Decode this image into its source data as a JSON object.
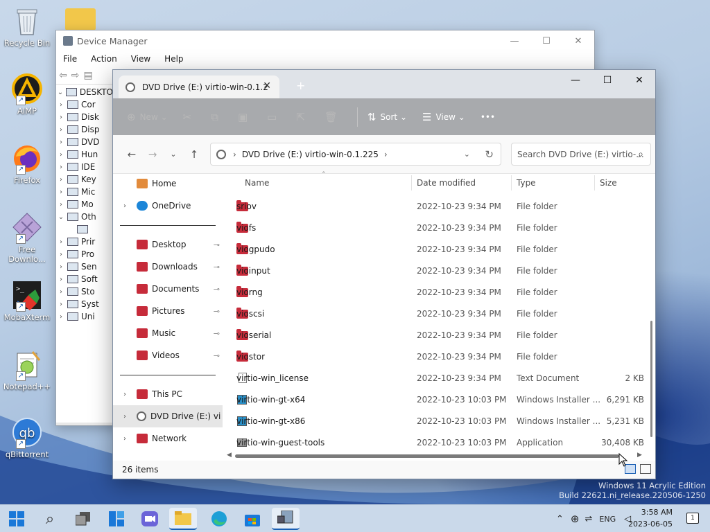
{
  "desktop": {
    "icons": [
      {
        "label": "Recycle Bin"
      },
      {
        "label": "AIMP"
      },
      {
        "label": "Firefox"
      },
      {
        "label": "Free Downlo..."
      },
      {
        "label": "MobaXterm"
      },
      {
        "label": "Notepad++"
      },
      {
        "label": "qBittorrent"
      }
    ],
    "watermark": {
      "line1": "Windows 11 Acrylic Edition",
      "line2": "Build 22621.ni_release.220506-1250"
    }
  },
  "device_manager": {
    "title": "Device Manager",
    "menu": [
      "File",
      "Action",
      "View",
      "Help"
    ],
    "tree": [
      {
        "label": "DESKTO",
        "chev": "⌄"
      },
      {
        "label": "Cor",
        "chev": "›"
      },
      {
        "label": "Disk",
        "chev": "›"
      },
      {
        "label": "Disp",
        "chev": "›"
      },
      {
        "label": "DVD",
        "chev": "›"
      },
      {
        "label": "Hun",
        "chev": "›"
      },
      {
        "label": "IDE",
        "chev": "›"
      },
      {
        "label": "Key",
        "chev": "›"
      },
      {
        "label": "Mic",
        "chev": "›"
      },
      {
        "label": "Mo",
        "chev": "›"
      },
      {
        "label": "Oth",
        "chev": "⌄"
      },
      {
        "label": "",
        "chev": ""
      },
      {
        "label": "Prir",
        "chev": "›"
      },
      {
        "label": "Pro",
        "chev": "›"
      },
      {
        "label": "Sen",
        "chev": "›"
      },
      {
        "label": "Soft",
        "chev": "›"
      },
      {
        "label": "Sto",
        "chev": "›"
      },
      {
        "label": "Syst",
        "chev": "›"
      },
      {
        "label": "Uni",
        "chev": "›"
      }
    ]
  },
  "explorer": {
    "tab_title": "DVD Drive (E:) virtio-win-0.1.2",
    "toolbar": {
      "new_label": "New",
      "sort_label": "Sort",
      "view_label": "View",
      "more_label": "•••"
    },
    "address": {
      "path": "DVD Drive (E:) virtio-win-0.1.225",
      "search_placeholder": "Search DVD Drive (E:) virtio-..."
    },
    "nav_pane": {
      "home": "Home",
      "onedrive": "OneDrive",
      "quick_access": [
        "Desktop",
        "Downloads",
        "Documents",
        "Pictures",
        "Music",
        "Videos"
      ],
      "this_pc": "This PC",
      "dvd_drive": "DVD Drive (E:) virtio",
      "network": "Network"
    },
    "columns": {
      "name": "Name",
      "date": "Date modified",
      "type": "Type",
      "size": "Size"
    },
    "files": [
      {
        "name": "sriov",
        "date": "2022-10-23 9:34 PM",
        "type": "File folder",
        "size": "",
        "icon": "folder"
      },
      {
        "name": "viofs",
        "date": "2022-10-23 9:34 PM",
        "type": "File folder",
        "size": "",
        "icon": "folder"
      },
      {
        "name": "viogpudo",
        "date": "2022-10-23 9:34 PM",
        "type": "File folder",
        "size": "",
        "icon": "folder"
      },
      {
        "name": "vioinput",
        "date": "2022-10-23 9:34 PM",
        "type": "File folder",
        "size": "",
        "icon": "folder"
      },
      {
        "name": "viorng",
        "date": "2022-10-23 9:34 PM",
        "type": "File folder",
        "size": "",
        "icon": "folder"
      },
      {
        "name": "vioscsi",
        "date": "2022-10-23 9:34 PM",
        "type": "File folder",
        "size": "",
        "icon": "folder"
      },
      {
        "name": "vioserial",
        "date": "2022-10-23 9:34 PM",
        "type": "File folder",
        "size": "",
        "icon": "folder"
      },
      {
        "name": "viostor",
        "date": "2022-10-23 9:34 PM",
        "type": "File folder",
        "size": "",
        "icon": "folder"
      },
      {
        "name": "virtio-win_license",
        "date": "2022-10-23 9:34 PM",
        "type": "Text Document",
        "size": "2 KB",
        "icon": "doc"
      },
      {
        "name": "virtio-win-gt-x64",
        "date": "2022-10-23 10:03 PM",
        "type": "Windows Installer ...",
        "size": "6,291 KB",
        "icon": "msi"
      },
      {
        "name": "virtio-win-gt-x86",
        "date": "2022-10-23 10:03 PM",
        "type": "Windows Installer ...",
        "size": "5,231 KB",
        "icon": "msi"
      },
      {
        "name": "virtio-win-guest-tools",
        "date": "2022-10-23 10:03 PM",
        "type": "Application",
        "size": "30,408 KB",
        "icon": "app"
      }
    ],
    "status": "26 items"
  },
  "taskbar": {
    "language": "ENG",
    "time": "3:58 AM",
    "date": "2023-06-05",
    "notifications": "1"
  },
  "colors": {
    "folder": "#c62b3a",
    "accent": "#1a5fb4",
    "command_bar": "#a8aaad"
  }
}
